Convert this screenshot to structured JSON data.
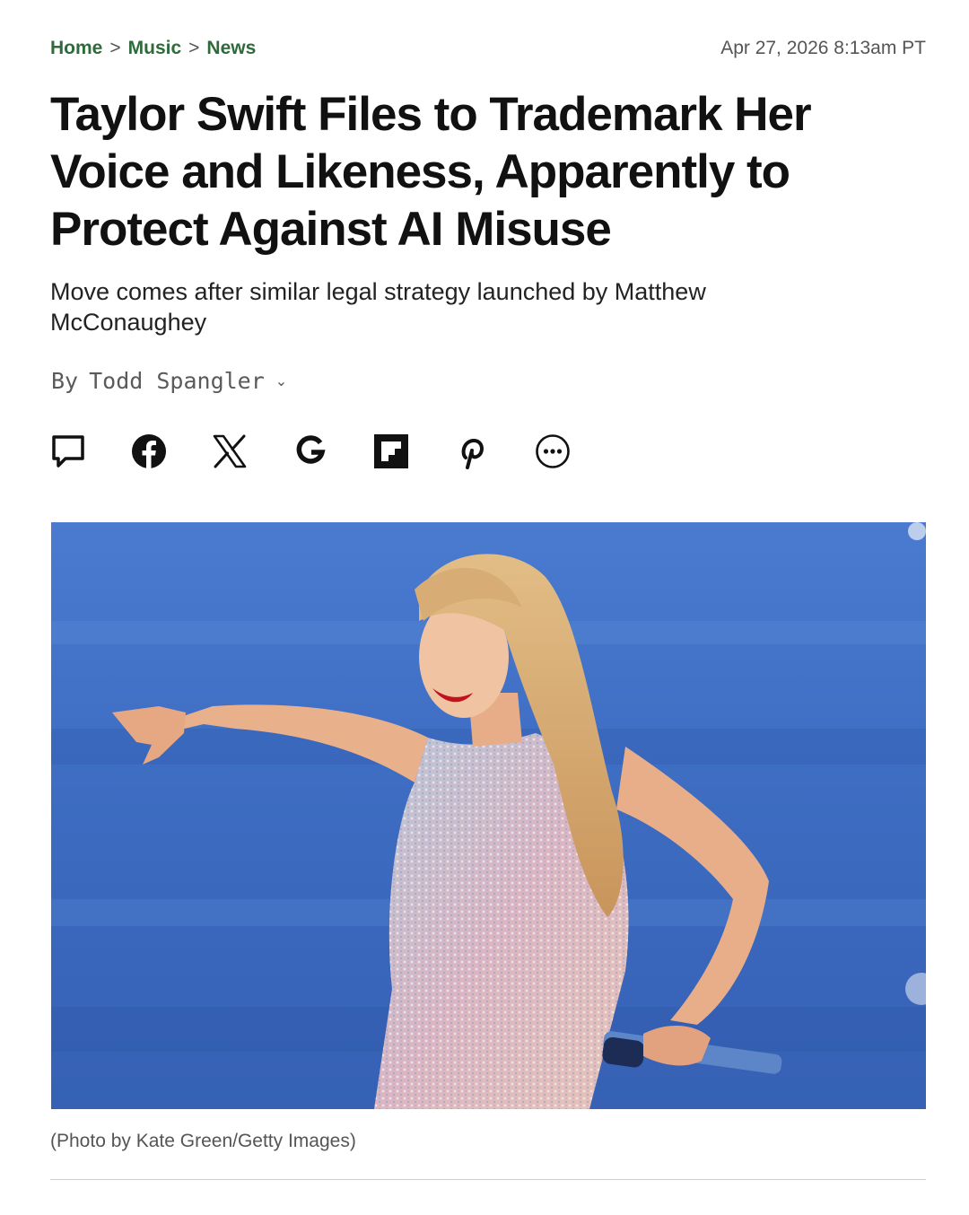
{
  "breadcrumb": {
    "items": [
      "Home",
      "Music",
      "News"
    ],
    "separator": ">"
  },
  "date": "Apr 27, 2026 8:13am PT",
  "headline": "Taylor Swift Files to Trademark Her Voice and Likeness, Apparently to Protect Against AI Misuse",
  "dek": "Move comes after similar legal strategy launched by Matthew McConaughey",
  "byline": {
    "prefix": "By",
    "author": "Todd Spangler"
  },
  "share_icons": [
    "comment-icon",
    "facebook-icon",
    "x-icon",
    "google-icon",
    "flipboard-icon",
    "pinterest-icon",
    "more-icon"
  ],
  "photo": {
    "caption": "(Photo by Kate Green/Getty Images)"
  },
  "colors": {
    "breadcrumb": "#2e6b3a",
    "stage_blue": "#3f6fc2"
  }
}
